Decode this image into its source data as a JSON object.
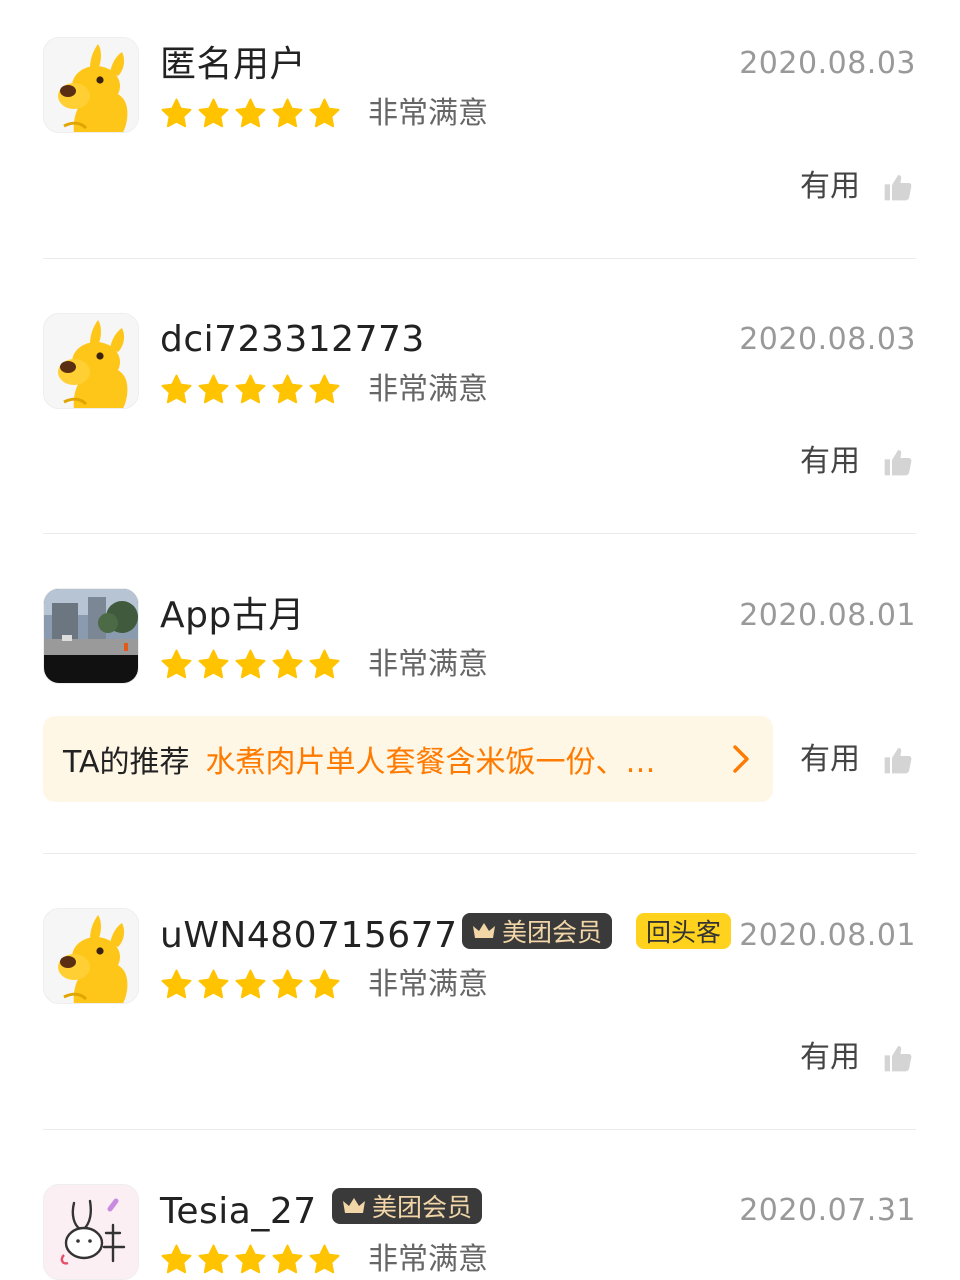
{
  "reviews": [
    {
      "username": "匿名用户",
      "date": "2020.08.03",
      "avatar_icon": "kangaroo-mascot-avatar",
      "rating": 5,
      "rating_text": "非常满意",
      "useful_label": "有用"
    },
    {
      "username": "dci723312773",
      "date": "2020.08.03",
      "avatar_icon": "kangaroo-mascot-avatar",
      "rating": 5,
      "rating_text": "非常满意",
      "useful_label": "有用"
    },
    {
      "username": "App古月",
      "date": "2020.08.01",
      "avatar_icon": "street-photo-avatar",
      "rating": 5,
      "rating_text": "非常满意",
      "recommend_label": "TA的推荐",
      "recommend_text": "水煮肉片单人套餐含米饭一份、…",
      "useful_label": "有用"
    },
    {
      "username": "uWN480715677",
      "date": "2020.08.01",
      "avatar_icon": "kangaroo-mascot-avatar",
      "member_badge": "美团会员",
      "return_badge": "回头客",
      "rating": 5,
      "rating_text": "非常满意",
      "useful_label": "有用"
    },
    {
      "username": "Tesia_27",
      "date": "2020.07.31",
      "avatar_icon": "bunny-drawing-avatar",
      "member_badge": "美团会员",
      "rating": 5,
      "rating_text": "非常满意"
    }
  ],
  "colors": {
    "star": "#ffc300",
    "recommend_bg": "#fff7e6",
    "recommend_text": "#ff7a00",
    "member_badge_bg": "#3a3a3a",
    "member_badge_text": "#f3d6a8",
    "return_badge_bg": "#ffd21e",
    "divider": "#ececec",
    "muted_text": "#999999"
  }
}
